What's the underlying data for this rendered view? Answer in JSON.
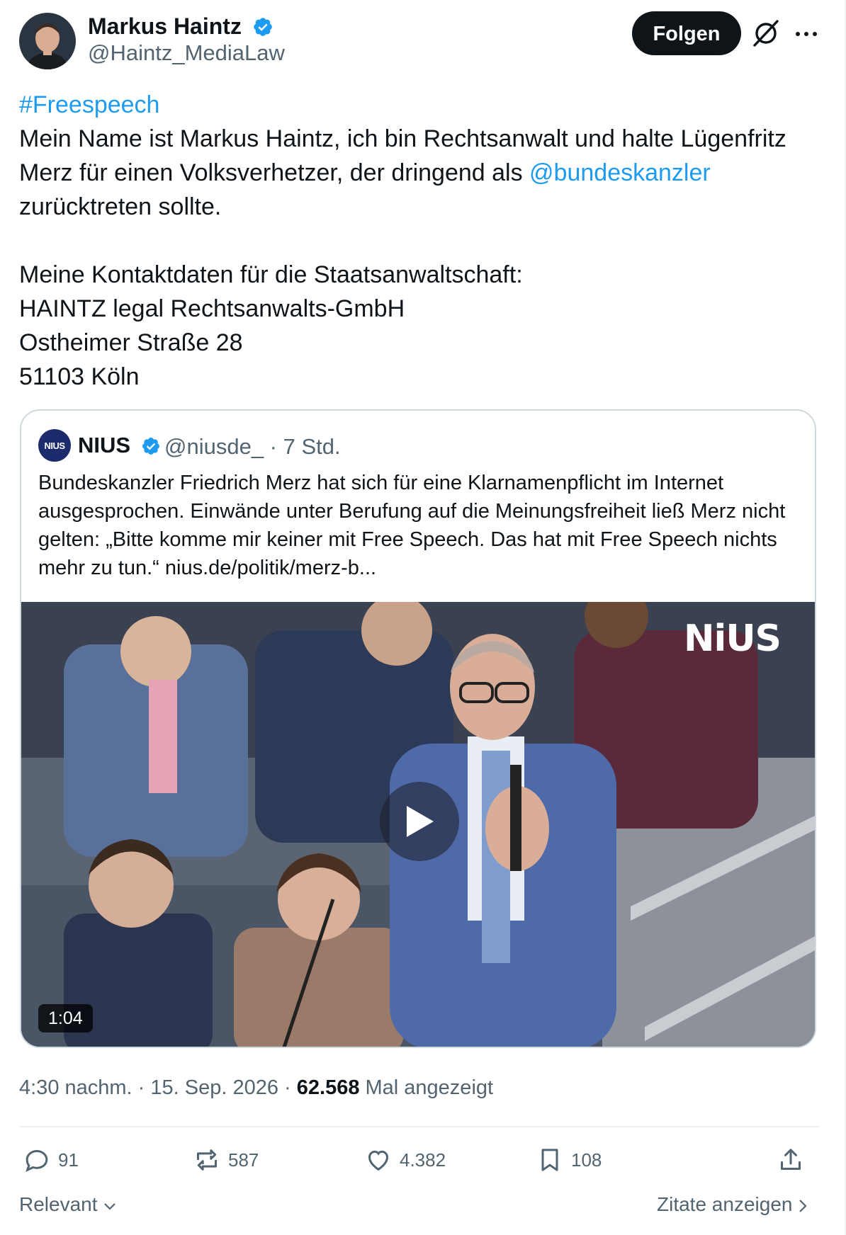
{
  "author": {
    "name": "Markus Haintz",
    "handle": "@Haintz_MediaLaw",
    "follow_label": "Folgen"
  },
  "tweet": {
    "hashtag": "#Freespeech",
    "line1": "Mein Name ist Markus Haintz, ich bin Rechtsanwalt und halte Lügenfritz Merz für einen Volksverhetzer, der dringend als ",
    "mention": "@bundeskanzler",
    "line1_end": "zurücktreten sollte.",
    "contact_intro": "Meine Kontaktdaten für die Staatsanwaltschaft:",
    "contact_company": "HAINTZ legal Rechtsanwalts-GmbH",
    "contact_street": "Ostheimer Straße 28",
    "contact_city": "51103 Köln"
  },
  "quote": {
    "avatar_text": "NIUS",
    "name": "NIUS",
    "handle": "@niusde_ · 7 Std.",
    "text": "Bundeskanzler Friedrich Merz hat sich für eine Klarnamenpflicht im Internet ausgesprochen. Einwände unter Berufung auf die Meinungsfreiheit ließ Merz nicht gelten: „Bitte komme mir keiner mit Free Speech. Das hat mit Free Speech nichts mehr zu tun.“ nius.de/politik/merz-b...",
    "watermark": "NiUS",
    "duration": "1:04"
  },
  "meta": {
    "time": "4:30 nachm. · 15. Sep. 2026 · ",
    "views": "62.568",
    "views_label": " Mal angezeigt"
  },
  "actions": {
    "replies": "91",
    "reposts": "587",
    "likes": "4.382",
    "bookmarks": "108"
  },
  "footer": {
    "sort_label": "Relevant",
    "quotes_label": "Zitate anzeigen"
  },
  "colors": {
    "link": "#1d9bf0",
    "verified": "#1d9bf0",
    "muted": "#536471"
  }
}
